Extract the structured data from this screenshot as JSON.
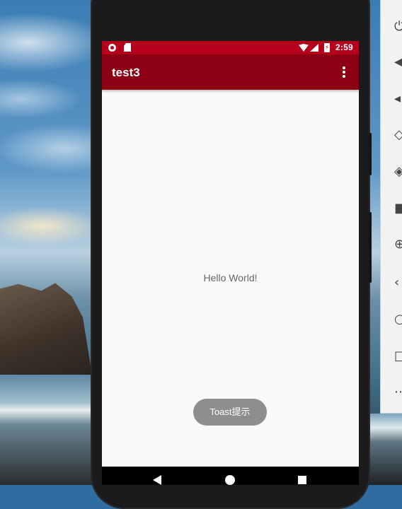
{
  "status_bar": {
    "time": "2:59",
    "icons": [
      "screen-record-icon",
      "sd-card-icon",
      "wifi-icon",
      "signal-icon",
      "battery-charging-icon"
    ]
  },
  "app_bar": {
    "title": "test3",
    "menu_icon": "overflow-menu-icon"
  },
  "content": {
    "text": "Hello World!"
  },
  "toast": {
    "text": "Toast提示"
  },
  "nav_bar": {
    "buttons": [
      "back-icon",
      "home-icon",
      "recents-icon"
    ]
  },
  "emulator_panel": {
    "buttons": [
      "power-icon",
      "volume-up-icon",
      "volume-down-icon",
      "rotate-left-icon",
      "rotate-right-icon",
      "camera-icon",
      "zoom-icon",
      "back-icon",
      "home-icon",
      "overview-icon",
      "more-icon"
    ]
  },
  "colors": {
    "status_bar": "#b5001c",
    "app_bar": "#8b0013",
    "toast": "#8e8e8e",
    "screen_bg": "#fafafa"
  }
}
